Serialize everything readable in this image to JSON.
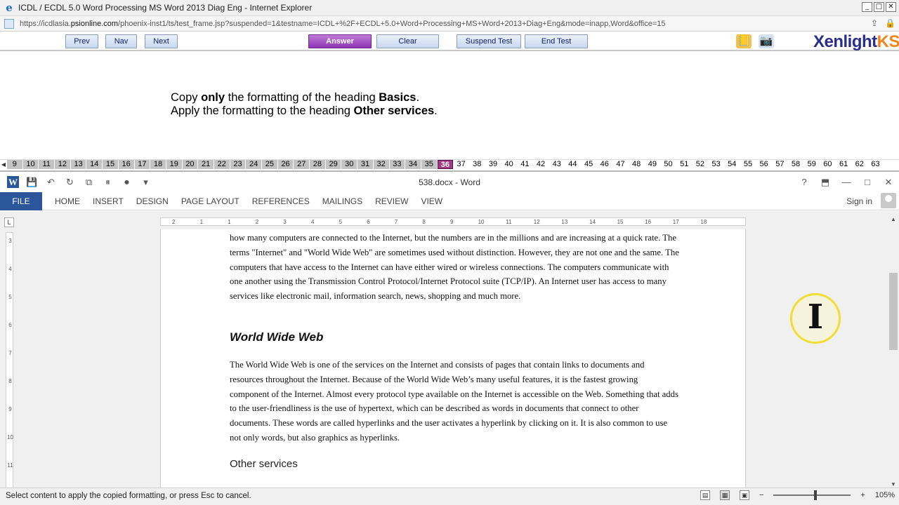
{
  "browser": {
    "title": "ICDL / ECDL 5.0 Word Processing MS Word 2013 Diag Eng - Internet Explorer",
    "url_prefix": "https://icdlasia.",
    "url_domain": "psionline.com",
    "url_path": "/phoenix-inst1/ts/test_frame.jsp?suspended=1&testname=ICDL+%2F+ECDL+5.0+Word+Processing+MS+Word+2013+Diag+Eng&mode=inapp,Word&office=15"
  },
  "toolbar": {
    "prev_label": "Prev",
    "nav_label": "Nav",
    "next_label": "Next",
    "answer_label": "Answer",
    "clear_label": "Clear",
    "suspend_label": "Suspend Test",
    "end_label": "End Test",
    "logo_main": "Xenlight",
    "logo_accent": "KS"
  },
  "question": {
    "line1": [
      {
        "text": "Copy ",
        "bold": false
      },
      {
        "text": "only",
        "bold": true
      },
      {
        "text": " the formatting of the heading ",
        "bold": false
      },
      {
        "text": "Basics",
        "bold": true
      },
      {
        "text": ".",
        "bold": false
      }
    ],
    "line2": [
      {
        "text": "Apply the formatting to the heading ",
        "bold": false
      },
      {
        "text": "Other services",
        "bold": true
      },
      {
        "text": ".",
        "bold": false
      }
    ]
  },
  "question_strip": {
    "numbers": [
      9,
      10,
      11,
      12,
      13,
      14,
      15,
      16,
      17,
      18,
      19,
      20,
      21,
      22,
      23,
      24,
      25,
      26,
      27,
      28,
      29,
      30,
      31,
      32,
      33,
      34,
      35,
      36,
      37,
      38,
      39,
      40,
      41,
      42,
      43,
      44,
      45,
      46,
      47,
      48,
      49,
      50,
      51,
      52,
      53,
      54,
      55,
      56,
      57,
      58,
      59,
      60,
      61,
      62,
      63
    ],
    "current": 36,
    "answered_up_to": 35
  },
  "word": {
    "title": "538.docx - Word",
    "tabs": [
      "FILE",
      "HOME",
      "INSERT",
      "DESIGN",
      "PAGE LAYOUT",
      "REFERENCES",
      "MAILINGS",
      "REVIEW",
      "VIEW"
    ],
    "sign_in": "Sign in",
    "ruler_h_numbers": [
      "2",
      "1",
      "1",
      "2",
      "3",
      "4",
      "5",
      "6",
      "7",
      "8",
      "9",
      "10",
      "11",
      "12",
      "13",
      "14",
      "15",
      "16",
      "17",
      "18"
    ],
    "ruler_v_numbers": [
      "3",
      "4",
      "5",
      "6",
      "7",
      "8",
      "9",
      "10",
      "11"
    ],
    "doc": {
      "para1": "how many computers are connected to the Internet, but the numbers are in the millions and are increasing at a quick rate. The terms \"Internet\" and \"World Wide Web\" are sometimes used without distinction. However, they are not one and the same. The computers that have access to the Internet can have either wired or wireless connections. The computers communicate with one another using the Transmission Control Protocol/Internet Protocol suite (TCP/IP). An Internet user has access to many services like electronic mail, information search, news, shopping and much more.",
      "heading_www": "World Wide Web",
      "para2": "The World Wide Web is one of the services on the Internet and consists of pages that contain links to documents and resources throughout the Internet. Because of the World Wide Web’s many useful features, it is the fastest growing component of the Internet. Almost every protocol type available on the Internet is accessible on the Web. Something that adds to the user-friendliness is the use of hypertext, which can be described as words in documents that connect to other documents. These words are called hyperlinks and the user activates a hyperlink by clicking on it. It is also common to use not only words, but also graphics as hyperlinks.",
      "heading_other": "Other services"
    },
    "status_message": "Select content to apply the copied formatting, or press Esc to cancel.",
    "zoom": "105%"
  }
}
